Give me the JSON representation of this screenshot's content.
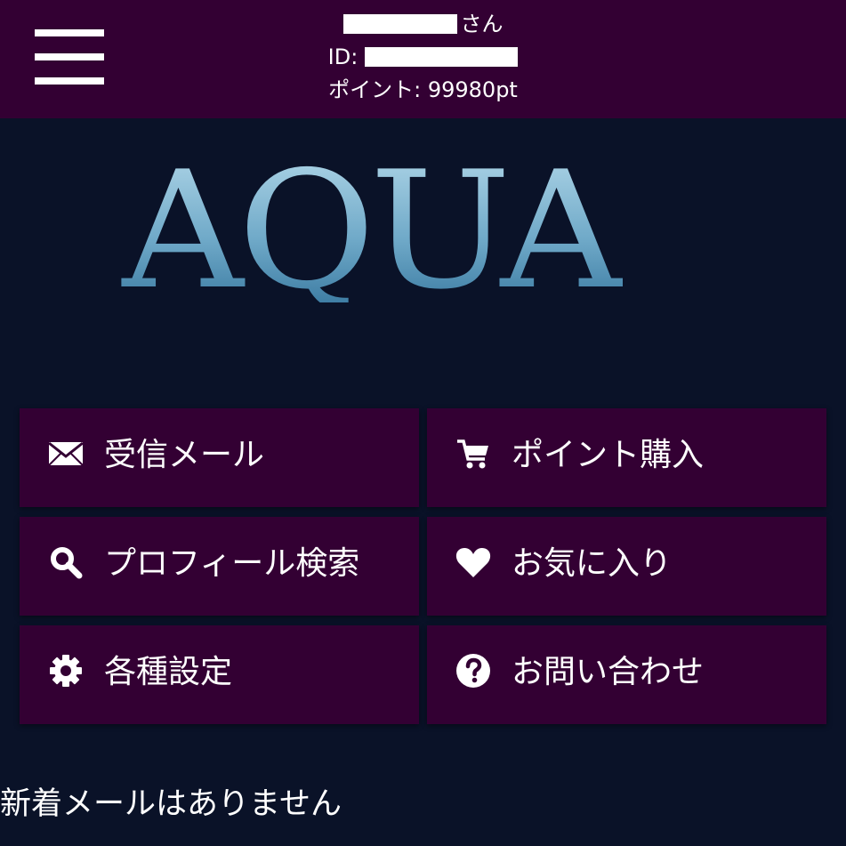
{
  "header": {
    "menu_icon": "hamburger-menu-icon",
    "name_suffix": "さん",
    "id_label": "ID:",
    "points_text": "ポイント: 99980pt",
    "background": "#330033"
  },
  "logo": {
    "text": "AQUA",
    "colors": [
      "#b8dcec",
      "#6fa9c8",
      "#2e6f98"
    ]
  },
  "menu": {
    "items": [
      {
        "label": "受信メール",
        "icon": "envelope-icon"
      },
      {
        "label": "ポイント購入",
        "icon": "cart-icon"
      },
      {
        "label": "プロフィール検索",
        "icon": "search-icon"
      },
      {
        "label": "お気に入り",
        "icon": "heart-icon"
      },
      {
        "label": "各種設定",
        "icon": "gear-icon"
      },
      {
        "label": "お問い合わせ",
        "icon": "question-icon"
      }
    ]
  },
  "status": {
    "message": "新着メールはありません"
  },
  "colors": {
    "page_background": "#0a1228",
    "tile_background": "#330033",
    "text": "#ffffff"
  }
}
